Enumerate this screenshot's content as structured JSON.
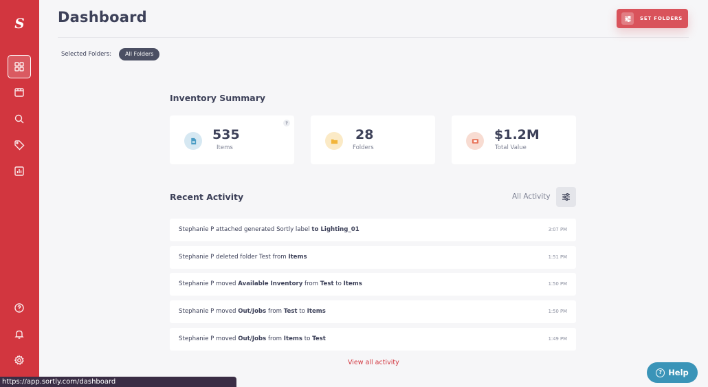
{
  "app": {
    "logo_text": "S",
    "brand_color": "#d2363f"
  },
  "sidebar": {
    "items": [
      {
        "name": "dashboard",
        "icon": "dashboard-grid-icon",
        "active": true
      },
      {
        "name": "items",
        "icon": "box-icon",
        "active": false
      },
      {
        "name": "search",
        "icon": "search-icon",
        "active": false
      },
      {
        "name": "tags",
        "icon": "tag-icon",
        "active": false
      },
      {
        "name": "reports",
        "icon": "bar-chart-icon",
        "active": false
      },
      {
        "name": "help",
        "icon": "question-circle-icon",
        "active": false
      },
      {
        "name": "notifications",
        "icon": "bell-icon",
        "active": false
      },
      {
        "name": "settings",
        "icon": "gear-icon",
        "active": false
      }
    ]
  },
  "header": {
    "title": "Dashboard",
    "set_folders_label": "SET FOLDERS"
  },
  "folders": {
    "label": "Selected Folders:",
    "selected": "All Folders"
  },
  "inventory_summary": {
    "title": "Inventory Summary",
    "help_mark": "?",
    "cards": [
      {
        "value": "535",
        "caption": "Items",
        "icon": "document-icon",
        "color": "#4a9cc4"
      },
      {
        "value": "28",
        "caption": "Folders",
        "icon": "folder-icon",
        "color": "#f2b53a"
      },
      {
        "value": "$1.2M",
        "caption": "Total Value",
        "icon": "money-icon",
        "color": "#e8755a"
      }
    ]
  },
  "recent_activity": {
    "title": "Recent Activity",
    "filter_label": "All Activity",
    "rows": [
      {
        "parts": [
          [
            "Stephanie P attached generated Sortly label ",
            false
          ],
          [
            "to ",
            true
          ],
          [
            "Lighting_01",
            true
          ]
        ],
        "time": "3:07 PM"
      },
      {
        "parts": [
          [
            "Stephanie P deleted folder Test from ",
            false
          ],
          [
            "Items",
            true
          ]
        ],
        "time": "1:51 PM"
      },
      {
        "parts": [
          [
            "Stephanie P moved ",
            false
          ],
          [
            "Available Inventory",
            true
          ],
          [
            " from ",
            false
          ],
          [
            "Test",
            true
          ],
          [
            " to ",
            false
          ],
          [
            "Items",
            true
          ]
        ],
        "time": "1:50 PM"
      },
      {
        "parts": [
          [
            "Stephanie P moved ",
            false
          ],
          [
            "Out/Jobs",
            true
          ],
          [
            " from ",
            false
          ],
          [
            "Test",
            true
          ],
          [
            " to ",
            false
          ],
          [
            "Items",
            true
          ]
        ],
        "time": "1:50 PM"
      },
      {
        "parts": [
          [
            "Stephanie P moved ",
            false
          ],
          [
            "Out/Jobs",
            true
          ],
          [
            " from ",
            false
          ],
          [
            "Items",
            true
          ],
          [
            " to ",
            false
          ],
          [
            "Test",
            true
          ]
        ],
        "time": "1:49 PM"
      }
    ],
    "view_all_label": "View all activity"
  },
  "help_button": {
    "label": "Help",
    "icon": "question-circle-icon"
  },
  "status_bar": {
    "url": "https://app.sortly.com/dashboard"
  }
}
